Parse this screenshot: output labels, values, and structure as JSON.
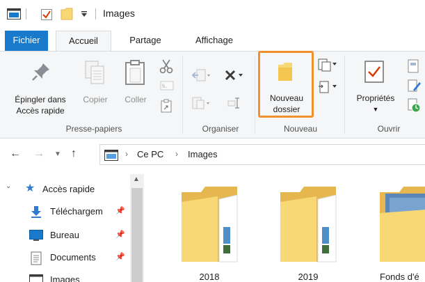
{
  "window": {
    "title": "Images"
  },
  "tabs": {
    "file": "Fichier",
    "home": "Accueil",
    "share": "Partage",
    "view": "Affichage"
  },
  "ribbon": {
    "clipboard": {
      "pin_line1": "Épingler dans",
      "pin_line2": "Accès rapide",
      "copy": "Copier",
      "paste": "Coller",
      "label": "Presse-papiers"
    },
    "organize": {
      "label": "Organiser"
    },
    "new": {
      "folder_line1": "Nouveau",
      "folder_line2": "dossier",
      "label": "Nouveau"
    },
    "open": {
      "properties": "Propriétés",
      "label": "Ouvrir"
    }
  },
  "address": {
    "root": "Ce PC",
    "current": "Images"
  },
  "navigation": {
    "quick_access": "Accès rapide",
    "items": [
      {
        "label": "Téléchargem",
        "icon": "download-icon"
      },
      {
        "label": "Bureau",
        "icon": "desktop-icon"
      },
      {
        "label": "Documents",
        "icon": "document-icon"
      },
      {
        "label": "Images",
        "icon": "pictures-icon"
      }
    ]
  },
  "folders": [
    {
      "name": "2018"
    },
    {
      "name": "2019"
    },
    {
      "name": "Fonds d'é"
    }
  ],
  "colors": {
    "file_tab": "#1979ca",
    "highlight": "#f0902e",
    "folder": "#f8d775",
    "folder_dark": "#e6b74e",
    "ribbon_bg": "#f5f6f7"
  }
}
